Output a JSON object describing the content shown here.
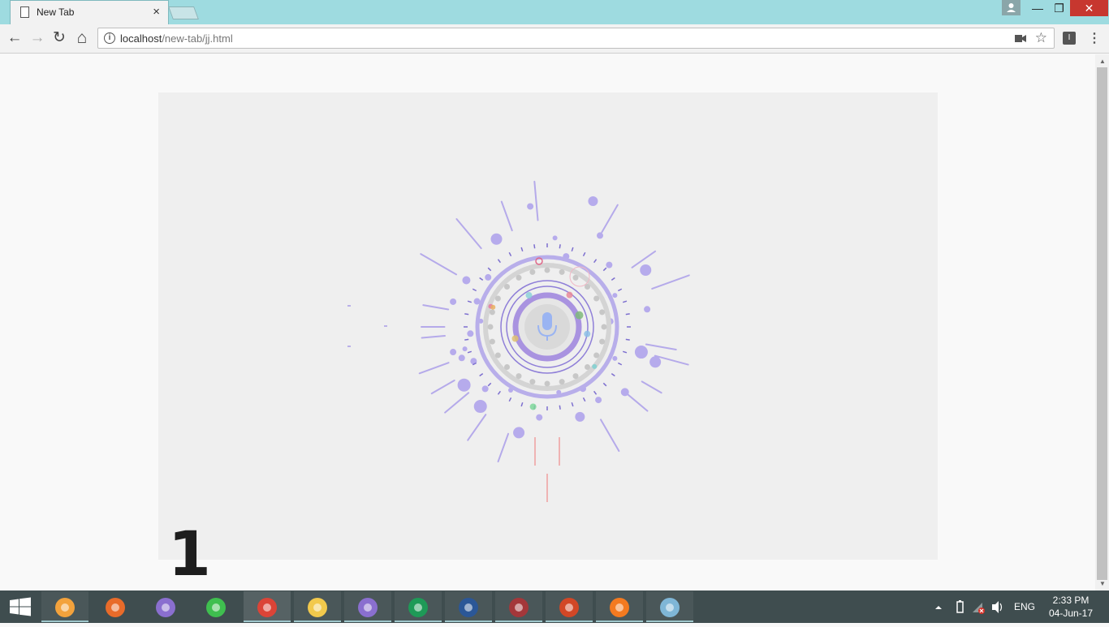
{
  "browser": {
    "tab_title": "New Tab",
    "tab_close": "×",
    "url_host": "localhost",
    "url_path": "/new-tab/jj.html",
    "info_glyph": "i",
    "star_glyph": "☆",
    "ext_label": "I",
    "menu_glyph": "⋮",
    "nav": {
      "back": "←",
      "forward": "→",
      "reload": "↻",
      "home": "⌂"
    },
    "window": {
      "minimize": "—",
      "maximize": "❐",
      "close": "✕"
    }
  },
  "page": {
    "overlay_number": "1"
  },
  "icons": {
    "mic": "microphone-icon",
    "start": "windows-start-icon"
  },
  "taskbar": {
    "apps": [
      "media-player",
      "firefox",
      "bittorrent",
      "whatsapp",
      "chrome",
      "file-explorer",
      "bittorrent-2",
      "visual-studio",
      "word",
      "access",
      "powerpoint",
      "xampp",
      "paint"
    ],
    "language": "ENG",
    "time": "2:33 PM",
    "date": "04-Jun-17"
  },
  "colors": {
    "titlebar": "#9edbe0",
    "accent_purple": "#a99be6",
    "taskbar": "#3f4d4f"
  }
}
